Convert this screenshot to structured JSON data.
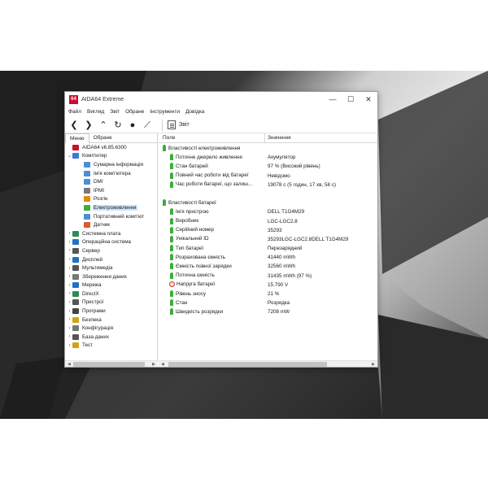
{
  "window": {
    "title": "AIDA64 Extreme",
    "app_icon_text": "64",
    "minimize": "—",
    "maximize": "☐",
    "close": "✕"
  },
  "menu": [
    "Файл",
    "Вигляд",
    "Звіт",
    "Обране",
    "Інструменти",
    "Довідка"
  ],
  "toolbar": {
    "back": "❮",
    "forward": "❯",
    "up": "⌃",
    "refresh": "↻",
    "user": "●",
    "chart": "⟋",
    "report_label": "Звіт"
  },
  "tabs": {
    "menu": "Меню",
    "favorites": "Обране"
  },
  "tree": [
    {
      "label": "AIDA64 v6.85.6300",
      "level": 0,
      "caret": "",
      "icon": "aida-icon",
      "color": "#c8102e"
    },
    {
      "label": "Комп'ютер",
      "level": 0,
      "caret": "⌄",
      "icon": "computer-icon",
      "color": "#3a7bd5"
    },
    {
      "label": "Сумарна інформація",
      "level": 1,
      "caret": "",
      "icon": "summary-icon",
      "color": "#4a8fd8"
    },
    {
      "label": "Ім'я комп'ютера",
      "level": 1,
      "caret": "",
      "icon": "computer-name-icon",
      "color": "#4a8fd8"
    },
    {
      "label": "DMI",
      "level": 1,
      "caret": "",
      "icon": "dmi-icon",
      "color": "#4a8fd8"
    },
    {
      "label": "IPMI",
      "level": 1,
      "caret": "",
      "icon": "ipmi-icon",
      "color": "#777777"
    },
    {
      "label": "Розгін",
      "level": 1,
      "caret": "",
      "icon": "overclock-icon",
      "color": "#e08a00"
    },
    {
      "label": "Електроживлення",
      "level": 1,
      "caret": "",
      "icon": "power-icon",
      "color": "#3cae3c",
      "selected": true
    },
    {
      "label": "Портативний комп'ют",
      "level": 1,
      "caret": "",
      "icon": "laptop-icon",
      "color": "#4a8fd8"
    },
    {
      "label": "Датчик",
      "level": 1,
      "caret": "",
      "icon": "sensor-icon",
      "color": "#e05a2b"
    },
    {
      "label": "Системна плата",
      "level": 0,
      "caret": "›",
      "icon": "motherboard-icon",
      "color": "#2e8b57"
    },
    {
      "label": "Операційна система",
      "level": 0,
      "caret": "›",
      "icon": "os-icon",
      "color": "#1e73be"
    },
    {
      "label": "Сервер",
      "level": 0,
      "caret": "›",
      "icon": "server-icon",
      "color": "#555555"
    },
    {
      "label": "Дисплей",
      "level": 0,
      "caret": "›",
      "icon": "display-icon",
      "color": "#1e73be"
    },
    {
      "label": "Мультимедіа",
      "level": 0,
      "caret": "›",
      "icon": "multimedia-icon",
      "color": "#555555"
    },
    {
      "label": "Збереження даних",
      "level": 0,
      "caret": "›",
      "icon": "storage-icon",
      "color": "#777777"
    },
    {
      "label": "Мережа",
      "level": 0,
      "caret": "›",
      "icon": "network-icon",
      "color": "#1e73be"
    },
    {
      "label": "DirectX",
      "level": 0,
      "caret": "›",
      "icon": "directx-icon",
      "color": "#2e8b57"
    },
    {
      "label": "Пристрої",
      "level": 0,
      "caret": "›",
      "icon": "devices-icon",
      "color": "#555555"
    },
    {
      "label": "Програми",
      "level": 0,
      "caret": "›",
      "icon": "programs-icon",
      "color": "#444444"
    },
    {
      "label": "Безпека",
      "level": 0,
      "caret": "›",
      "icon": "security-icon",
      "color": "#d4a017"
    },
    {
      "label": "Конфігурація",
      "level": 0,
      "caret": "›",
      "icon": "config-icon",
      "color": "#777777"
    },
    {
      "label": "База даних",
      "level": 0,
      "caret": "›",
      "icon": "database-icon",
      "color": "#555555"
    },
    {
      "label": "Тест",
      "level": 0,
      "caret": "›",
      "icon": "test-icon",
      "color": "#d4a017"
    }
  ],
  "columns": {
    "field": "Поле",
    "value": "Значення"
  },
  "sections": [
    {
      "title": "Властивості електроживлення",
      "rows": [
        {
          "field": "Поточне джерело живлення",
          "value": "Акумулятор",
          "icon": "battery"
        },
        {
          "field": "Стан батарей",
          "value": "97 % (Високий рівень)",
          "icon": "battery"
        },
        {
          "field": "Повний час роботи від батареї",
          "value": "Невідомо",
          "icon": "battery"
        },
        {
          "field": "Час роботи батареї, що залиш...",
          "value": "19078 с (5 годин, 17 хв, 58 с)",
          "icon": "battery"
        }
      ]
    },
    {
      "title": "Властивості батареї",
      "rows": [
        {
          "field": "Ім'я пристрою",
          "value": "DELL T1G4M29",
          "icon": "battery"
        },
        {
          "field": "Виробник",
          "value": "LGC-LGC2.8",
          "icon": "battery"
        },
        {
          "field": "Серійний номер",
          "value": "35293",
          "icon": "battery"
        },
        {
          "field": "Унікальний ID",
          "value": "35293LGC-LGC2.8DELL T1G4M29",
          "icon": "battery"
        },
        {
          "field": "Тип батареї",
          "value": "Перезарядний",
          "icon": "battery"
        },
        {
          "field": "Розрахована ємність",
          "value": "41440 mWh",
          "icon": "battery"
        },
        {
          "field": "Ємність повної зарядки",
          "value": "32560 mWh",
          "icon": "battery"
        },
        {
          "field": "Поточна ємність",
          "value": "31435 mWh  (97 %)",
          "icon": "battery"
        },
        {
          "field": "Напруга батареї",
          "value": "15.790 V",
          "icon": "gauge"
        },
        {
          "field": "Рівень зносу",
          "value": "21 %",
          "icon": "battery"
        },
        {
          "field": "Стан",
          "value": "Розрядка",
          "icon": "battery"
        },
        {
          "field": "Швидкість розрядки",
          "value": "7208 mW",
          "icon": "battery"
        }
      ]
    }
  ]
}
